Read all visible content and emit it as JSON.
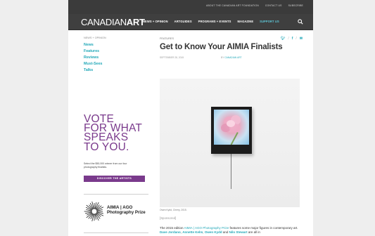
{
  "utility_bar": {
    "links": [
      "ABOUT THE CANADIAN ART FOUNDATION",
      "CONTACT US",
      "SUBSCRIBE"
    ]
  },
  "header": {
    "logo_part1": "CANADIAN",
    "logo_part2": "ART",
    "nav": [
      "NEWS + OPINION",
      "ARTGUIDES",
      "PROGRAMS + EVENTS",
      "MAGAZINE",
      "SUPPORT US"
    ],
    "search_icon": "search-icon"
  },
  "sidebar": {
    "breadcrumb": "NEWS + OPINION",
    "items": [
      "News",
      "Features",
      "Reviews",
      "Must-Sees",
      "Talks"
    ]
  },
  "ad": {
    "headline": [
      "VOTE",
      "FOR WHAT",
      "SPEAKS",
      "TO YOU."
    ],
    "description": "Select the $50,000 winner from our four photography finalists.",
    "button_label": "DISCOVER THE ARTISTS",
    "prize_line1": "AIMIA | AGO",
    "prize_line2": "Photography Prize"
  },
  "article": {
    "section": "FEATURES",
    "title": "Get to Know Your AIMIA Finalists",
    "date": "SEPTEMBER 28, 2015",
    "byline_prefix": "BY",
    "author": "CANADIAN ART",
    "share": [
      "Twitter",
      "Facebook",
      "Email"
    ],
    "caption": "Owen Kydd, Cherry, 2015.",
    "sponsored": "[Sponsored]",
    "body_prefix": "The 2015 edition ",
    "body_link": "AIMIA | AGO Photography Prize",
    "body_mid": " features some major figures in",
    "body_line2_prefix": "contemporary art. ",
    "name1": "Dave Jordano",
    "name2": "Annette Kelm",
    "name3": "Owen Kydd",
    "name4": "Nilo Stewart",
    "sep": ", ",
    "and": " and ",
    "body_suffix": " are all in"
  },
  "colors": {
    "accent": "#22a8b8",
    "ad_purple": "#7a3a8c",
    "header_bg": "#3f3f3f"
  }
}
